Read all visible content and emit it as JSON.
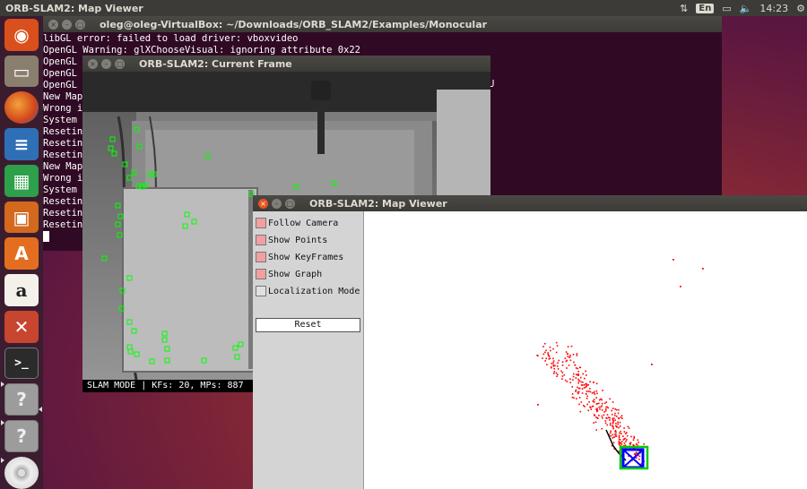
{
  "top_panel": {
    "app_title": "ORB-SLAM2: Map Viewer",
    "tray": {
      "network_icon": "network-arrows-icon",
      "keyboard_layout": "En",
      "battery_icon": "battery-icon",
      "volume_icon": "volume-icon",
      "volume_glyph": "🔈",
      "time": "14:23",
      "settings_icon": "gear-icon",
      "settings_glyph": "⚙"
    }
  },
  "launcher": {
    "items": [
      {
        "name": "ubuntu-dash",
        "glyph": "◉"
      },
      {
        "name": "files",
        "glyph": "▭"
      },
      {
        "name": "firefox",
        "glyph": ""
      },
      {
        "name": "libreoffice-writer",
        "glyph": "≡"
      },
      {
        "name": "libreoffice-calc",
        "glyph": "▦"
      },
      {
        "name": "libreoffice-impress",
        "glyph": "▣"
      },
      {
        "name": "software-center",
        "glyph": "A"
      },
      {
        "name": "amazon",
        "glyph": "a"
      },
      {
        "name": "system-settings",
        "glyph": "✕"
      },
      {
        "name": "terminal",
        "glyph": ">_"
      },
      {
        "name": "unknown-app-1",
        "glyph": "?"
      },
      {
        "name": "unknown-app-2",
        "glyph": "?"
      },
      {
        "name": "dvd",
        "glyph": ""
      }
    ]
  },
  "terminal": {
    "title": "oleg@oleg-VirtualBox: ~/Downloads/ORB_SLAM2/Examples/Monocular",
    "lines": [
      "libGL error: failed to load driver: vboxvideo",
      "OpenGL Warning: glXChooseVisual: ignoring attribute 0x22",
      "OpenGL",
      "OpenGL",
      "OpenGL",
      "New Map",
      "Wrong i",
      "System",
      "Resetin",
      "Resetin",
      "Resetin",
      "New Map",
      "Wrong i",
      "System",
      "Resetin",
      "Resetin",
      "Resetin",
      "New Map"
    ],
    "trailing_char": "U"
  },
  "current_frame": {
    "title": "ORB-SLAM2: Current Frame",
    "status": "SLAM MODE |  KFs: 20, MPs: 887"
  },
  "map_viewer": {
    "title": "ORB-SLAM2: Map Viewer",
    "options": [
      {
        "label": "Follow Camera",
        "checked": true
      },
      {
        "label": "Show Points",
        "checked": true
      },
      {
        "label": "Show KeyFrames",
        "checked": true
      },
      {
        "label": "Show Graph",
        "checked": true
      },
      {
        "label": "Localization Mode",
        "checked": false
      }
    ],
    "reset_label": "Reset"
  },
  "colors": {
    "terminal_bg": "#300a24",
    "map_point": "#ff0000",
    "keypoint": "#00ff00",
    "keyframe": "#0000ff",
    "current_camera": "#00cc00"
  }
}
